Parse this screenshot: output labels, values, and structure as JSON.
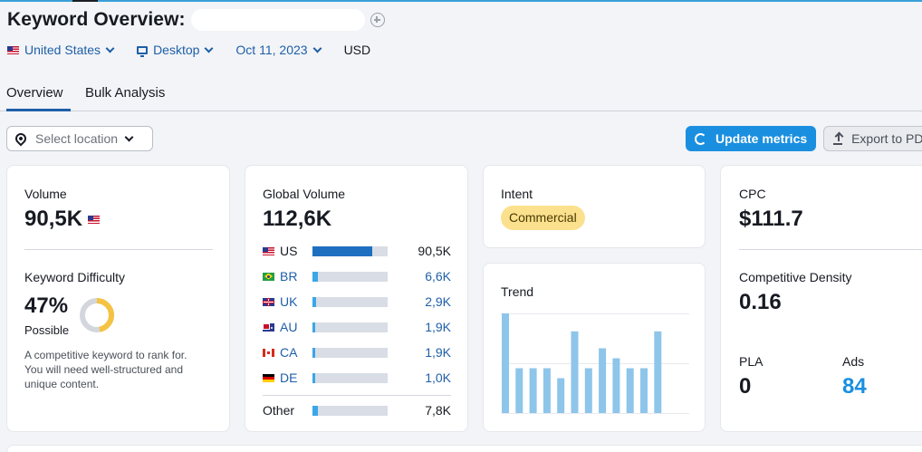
{
  "header": {
    "title": "Keyword Overview:",
    "filters": {
      "country": "United States",
      "device": "Desktop",
      "date": "Oct 11, 2023",
      "currency": "USD"
    }
  },
  "tabs": [
    {
      "label": "Overview",
      "active": true
    },
    {
      "label": "Bulk Analysis",
      "active": false
    }
  ],
  "toolbar": {
    "location_placeholder": "Select location",
    "update_label": "Update metrics",
    "export_label": "Export to PDF"
  },
  "volume": {
    "label": "Volume",
    "value": "90,5K"
  },
  "keyword_difficulty": {
    "label": "Keyword Difficulty",
    "value": "47%",
    "level": "Possible",
    "percent": 47,
    "description": "A competitive keyword to rank for. You will need well-structured and unique content."
  },
  "global_volume": {
    "label": "Global Volume",
    "value": "112,6K",
    "rows": [
      {
        "code": "US",
        "value": "90,5K",
        "fraction": 0.8,
        "color": "#1f6fc0",
        "link": false
      },
      {
        "code": "BR",
        "value": "6,6K",
        "fraction": 0.07,
        "color": "#3aa6e8",
        "link": true
      },
      {
        "code": "UK",
        "value": "2,9K",
        "fraction": 0.05,
        "color": "#3aa6e8",
        "link": true
      },
      {
        "code": "AU",
        "value": "1,9K",
        "fraction": 0.04,
        "color": "#3aa6e8",
        "link": true
      },
      {
        "code": "CA",
        "value": "1,9K",
        "fraction": 0.04,
        "color": "#3aa6e8",
        "link": true
      },
      {
        "code": "DE",
        "value": "1,0K",
        "fraction": 0.04,
        "color": "#3aa6e8",
        "link": true
      }
    ],
    "other": {
      "code": "Other",
      "value": "7,8K",
      "fraction": 0.07,
      "color": "#3aa6e8"
    }
  },
  "intent": {
    "label": "Intent",
    "value": "Commercial"
  },
  "trend": {
    "label": "Trend",
    "values": [
      1.0,
      0.45,
      0.45,
      0.45,
      0.35,
      0.82,
      0.45,
      0.65,
      0.55,
      0.45,
      0.45,
      0.82
    ]
  },
  "cpc": {
    "label": "CPC",
    "value": "$111.7"
  },
  "competitive_density": {
    "label": "Competitive Density",
    "value": "0.16"
  },
  "pla": {
    "label": "PLA",
    "value": "0"
  },
  "ads": {
    "label": "Ads",
    "value": "84"
  },
  "colors": {
    "accent": "#1a8fe0",
    "link": "#1f5fa8",
    "kd_fill": "#f5c342",
    "kd_track": "#d3d6dc",
    "intent_badge": "#fbe08d",
    "trend_bar": "#8ec5ea"
  }
}
